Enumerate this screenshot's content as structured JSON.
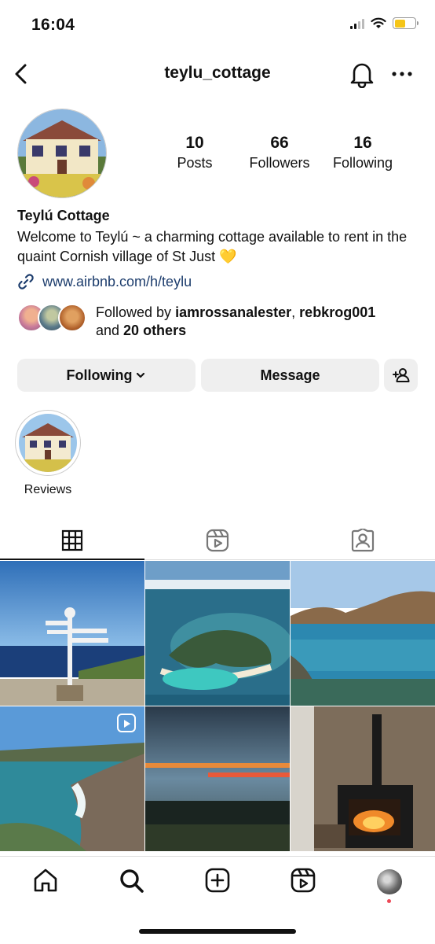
{
  "status_bar": {
    "time": "16:04"
  },
  "header": {
    "username": "teylu_cottage"
  },
  "profile": {
    "stats": [
      {
        "value": "10",
        "label": "Posts"
      },
      {
        "value": "66",
        "label": "Followers"
      },
      {
        "value": "16",
        "label": "Following"
      }
    ],
    "display_name": "Teylú Cottage",
    "bio": "Welcome to Teylú ~ a charming cottage available to rent in the quaint Cornish village of St Just 💛",
    "link": "www.airbnb.com/h/teylu",
    "followed_by": {
      "prefix": "Followed by ",
      "user1": "iamrossanalester",
      "separator": ", ",
      "user2": "rebkrog001",
      "and": "and ",
      "others": "20 others"
    }
  },
  "actions": {
    "following_label": "Following",
    "message_label": "Message"
  },
  "highlights": [
    {
      "label": "Reviews"
    }
  ],
  "tabs": [
    "grid-icon",
    "reels-icon",
    "tagged-icon"
  ],
  "nav": [
    "home-icon",
    "search-icon",
    "create-icon",
    "reels-icon",
    "profile-icon"
  ],
  "colors": {
    "link": "#1d3d6d",
    "button_bg": "#efefef",
    "notification_dot": "#ed4956",
    "heart": "#f2c230"
  }
}
